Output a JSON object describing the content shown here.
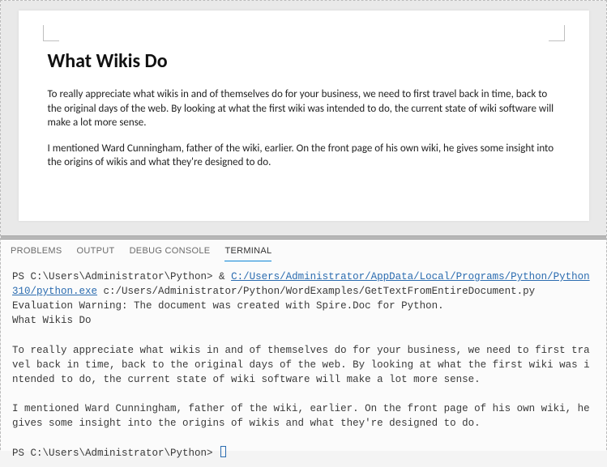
{
  "document": {
    "heading": "What Wikis Do",
    "para1": "To really appreciate what wikis in and of themselves do for your business, we need to first travel back in time, back to the original days of the web. By looking at what the first wiki was intended to do, the current state of wiki software will make a lot more sense.",
    "para2": "I mentioned Ward Cunningham, father of the wiki, earlier. On the front page of his own wiki, he gives some insight into the origins of wikis and what they're designed to do."
  },
  "tabs": {
    "problems": "PROBLEMS",
    "output": "OUTPUT",
    "debug": "DEBUG CONSOLE",
    "terminal": "TERMINAL"
  },
  "terminal": {
    "prompt1": "PS C:\\Users\\Administrator\\Python> ",
    "amp": "& ",
    "exe_link": "C:/Users/Administrator/AppData/Local/Programs/Python/Python310/python.exe",
    "script_arg": " c:/Users/Administrator/Python/WordExamples/GetTextFromEntireDocument.py",
    "warning": "Evaluation Warning: The document was created with Spire.Doc for Python.",
    "out_heading": "What Wikis Do",
    "out_para1": "To really appreciate what wikis in and of themselves do for your business, we need to first travel back in time, back to the original days of the web. By looking at what the first wiki was intended to do, the current state of wiki software will make a lot more sense.",
    "out_para2": "I mentioned Ward Cunningham, father of the wiki, earlier. On the front page of his own wiki, he gives some insight into the origins of wikis and what they're designed to do.",
    "prompt2": "PS C:\\Users\\Administrator\\Python> "
  }
}
